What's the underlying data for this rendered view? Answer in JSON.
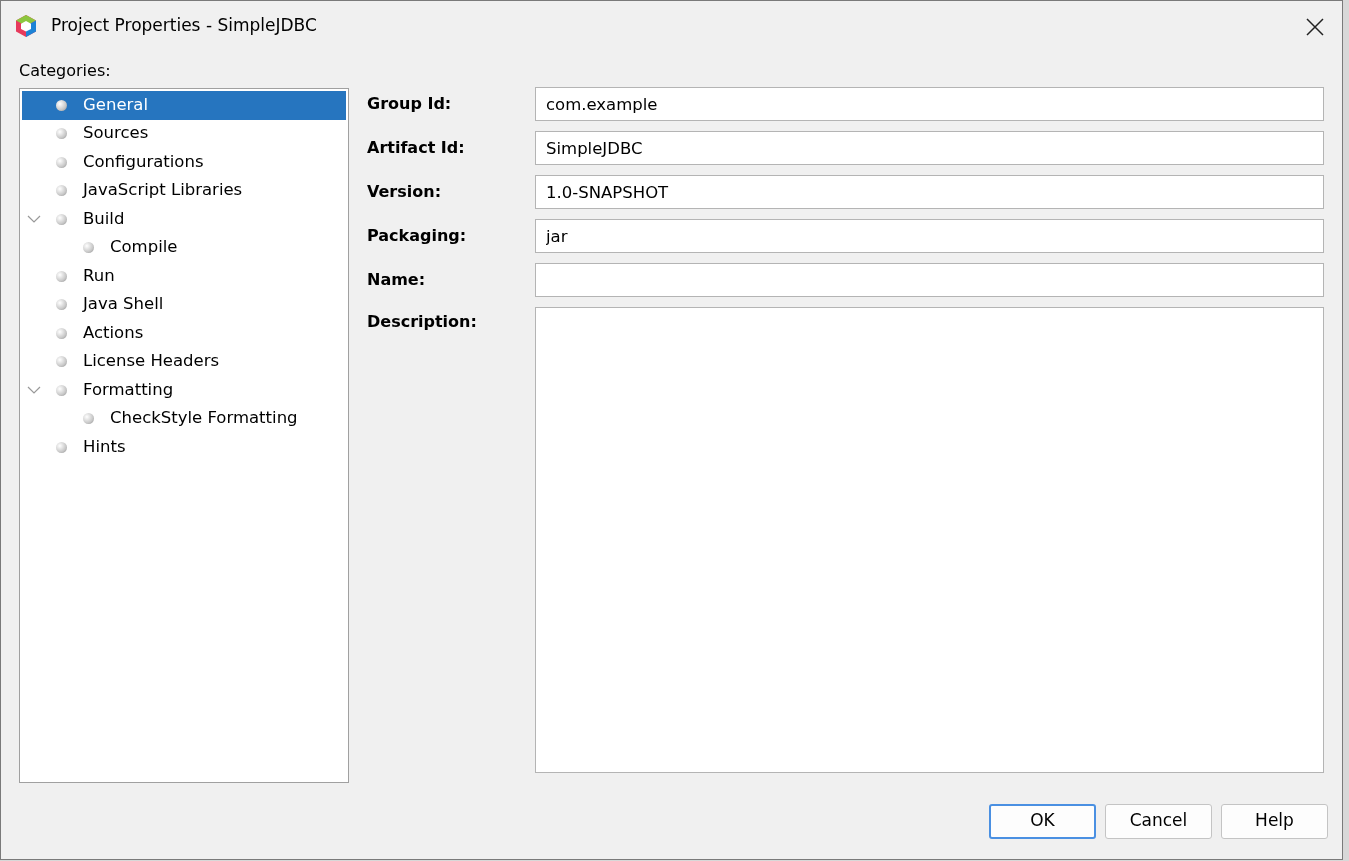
{
  "window": {
    "title": "Project Properties - SimpleJDBC"
  },
  "categories": {
    "label": "Categories:",
    "items": [
      {
        "label": "General",
        "selected": true
      },
      {
        "label": "Sources",
        "selected": false
      },
      {
        "label": "Configurations",
        "selected": false
      },
      {
        "label": "JavaScript Libraries",
        "selected": false
      },
      {
        "label": "Build",
        "selected": false,
        "expanded": true,
        "children": [
          {
            "label": "Compile",
            "selected": false
          }
        ]
      },
      {
        "label": "Run",
        "selected": false
      },
      {
        "label": "Java Shell",
        "selected": false
      },
      {
        "label": "Actions",
        "selected": false
      },
      {
        "label": "License Headers",
        "selected": false
      },
      {
        "label": "Formatting",
        "selected": false,
        "expanded": true,
        "children": [
          {
            "label": "CheckStyle Formatting",
            "selected": false
          }
        ]
      },
      {
        "label": "Hints",
        "selected": false
      }
    ]
  },
  "fields": [
    {
      "kind": "text",
      "label": "Group Id:",
      "value": "com.example"
    },
    {
      "kind": "text",
      "label": "Artifact Id:",
      "value": "SimpleJDBC"
    },
    {
      "kind": "text",
      "label": "Version:",
      "value": "1.0-SNAPSHOT"
    },
    {
      "kind": "text",
      "label": "Packaging:",
      "value": "jar"
    },
    {
      "kind": "text",
      "label": "Name:"
    },
    {
      "kind": "textarea",
      "label": "Description:"
    }
  ],
  "buttons": [
    {
      "label": "OK",
      "default": true
    },
    {
      "label": "Cancel",
      "default": false
    },
    {
      "label": "Help",
      "default": false
    }
  ]
}
